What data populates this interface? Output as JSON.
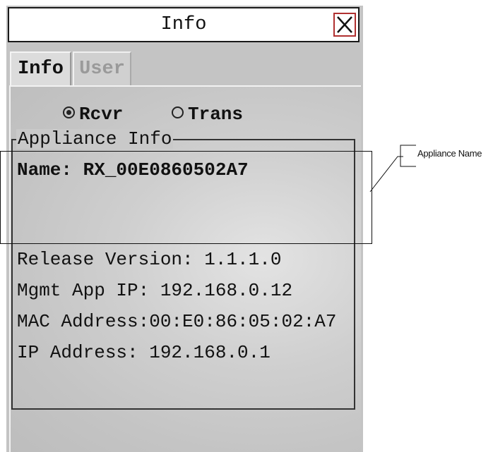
{
  "window": {
    "title": "Info",
    "close_icon": "close-x-icon"
  },
  "tabs": [
    {
      "label": "Info",
      "active": true
    },
    {
      "label": "User",
      "active": false
    }
  ],
  "mode": {
    "rcvr_label": "Rcvr",
    "trans_label": "Trans",
    "selected": "Rcvr"
  },
  "appliance_info": {
    "legend": "Appliance Info",
    "name": "Name: RX_00E0860502A7",
    "release_version": "Release Version: 1.1.1.0",
    "mgmt_app_ip": "Mgmt App IP: 192.168.0.12",
    "mac_address": "MAC Address:00:E0:86:05:02:A7",
    "ip_address": "IP Address: 192.168.0.1"
  },
  "callout": {
    "label": "Appliance Name"
  },
  "colors": {
    "close_border": "#b03030",
    "window_bg": "#c4c4c4"
  }
}
